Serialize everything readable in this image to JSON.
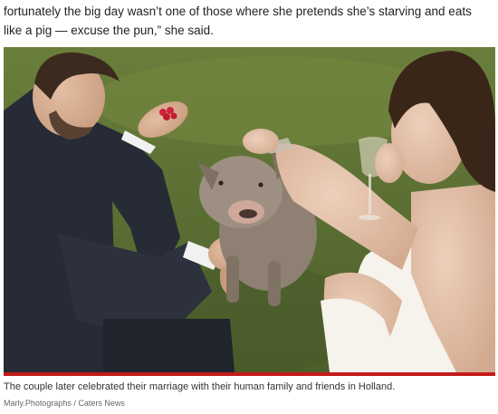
{
  "article": {
    "text": "fortunately the big day wasn’t one of those where she pretends she’s starving and eats like a pig — excuse the pun,” she said."
  },
  "photo": {
    "caption": "The couple later celebrated their marriage with their human family and friends in Holland.",
    "credit": "Marly.Photographs / Caters News"
  },
  "colors": {
    "caption_rule": "#c41a1a",
    "grass": "#56692f"
  }
}
